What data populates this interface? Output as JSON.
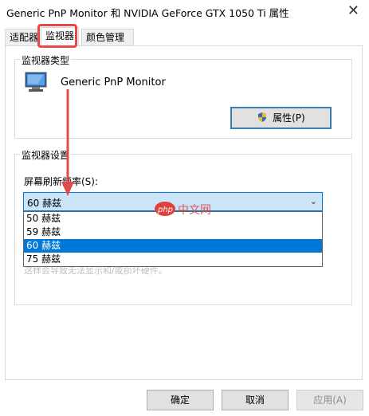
{
  "window": {
    "title": "Generic PnP Monitor 和 NVIDIA GeForce GTX 1050 Ti 属性",
    "close_glyph": "✕"
  },
  "tabs": [
    {
      "label": "适配器"
    },
    {
      "label": "监视器"
    },
    {
      "label": "颜色管理"
    }
  ],
  "monitor_type": {
    "group_title": "监视器类型",
    "monitor_name": "Generic PnP Monitor",
    "properties_button": "属性(P)"
  },
  "monitor_settings": {
    "group_title": "监视器设置",
    "refresh_label": "屏幕刷新频率(S):",
    "selected_value": "60 赫兹",
    "options": [
      "50 赫兹",
      "59 赫兹",
      "60 赫兹",
      "75 赫兹"
    ],
    "selected_index": 2,
    "partial_text": "这样会导致无法显示和/或损坏硬件。"
  },
  "footer": {
    "ok": "确定",
    "cancel": "取消",
    "apply": "应用(A)"
  },
  "watermark": {
    "text": "php 中文网"
  },
  "colors": {
    "selection": "#0078d7",
    "select_bg": "#cce4f7",
    "annotation_red": "#e34b4b",
    "button_bg": "#e1e1e1"
  }
}
